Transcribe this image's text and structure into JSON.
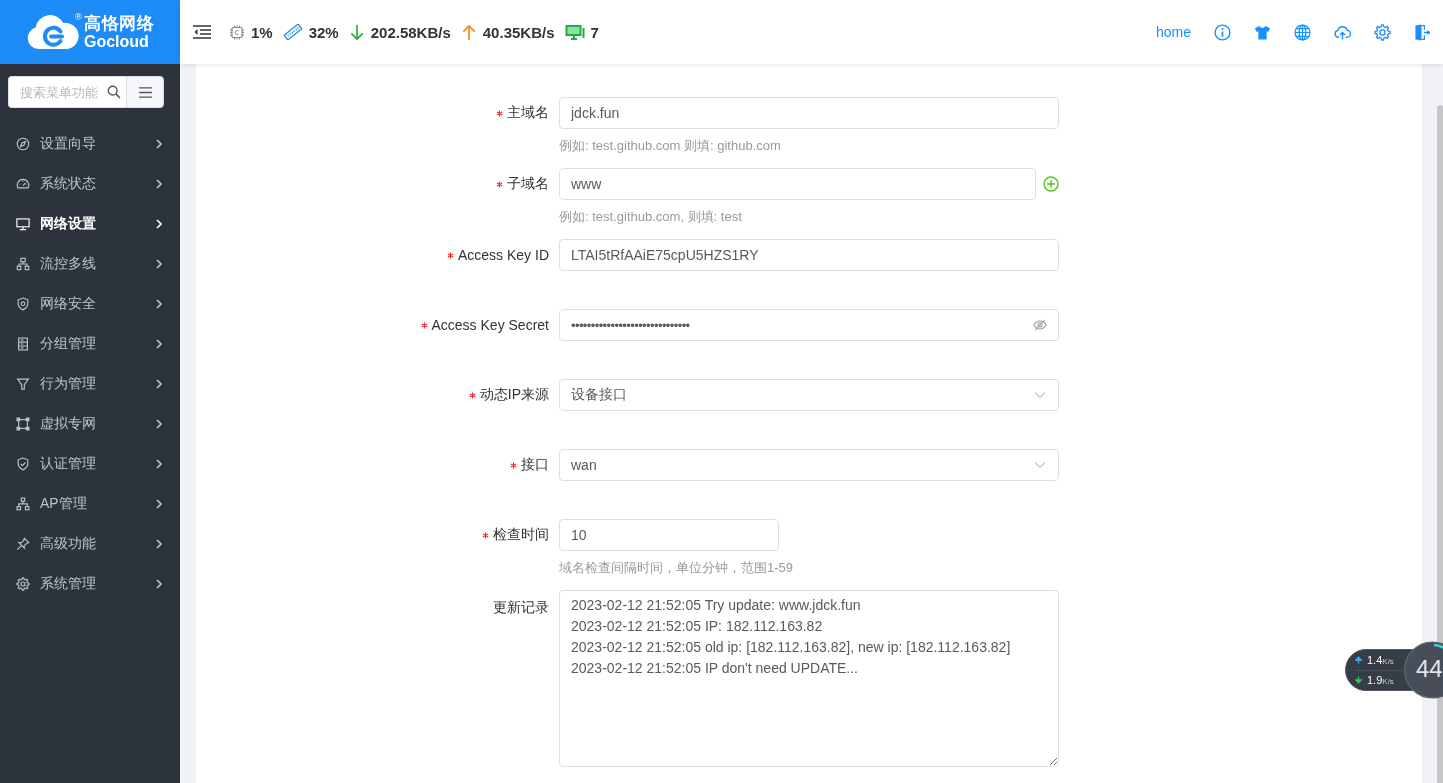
{
  "header": {
    "logo": {
      "brand_cn": "高恪网络",
      "brand_en": "Gocloud",
      "registered_mark": "®"
    },
    "stats": [
      {
        "kind": "cpu",
        "value": "1%"
      },
      {
        "kind": "memory",
        "value": "32%"
      },
      {
        "kind": "download",
        "value": "202.58KB/s"
      },
      {
        "kind": "upload",
        "value": "40.35KB/s"
      },
      {
        "kind": "devices",
        "value": "7"
      }
    ],
    "home_link": "home"
  },
  "sidebar": {
    "search": {
      "placeholder": "搜索菜单功能"
    },
    "items": [
      {
        "kind": "wizard",
        "label": "设置向导",
        "selected": false
      },
      {
        "kind": "status",
        "label": "系统状态",
        "selected": false
      },
      {
        "kind": "network",
        "label": "网络设置",
        "selected": true
      },
      {
        "kind": "flow",
        "label": "流控多线",
        "selected": false
      },
      {
        "kind": "security",
        "label": "网络安全",
        "selected": false
      },
      {
        "kind": "group",
        "label": "分组管理",
        "selected": false
      },
      {
        "kind": "behavior",
        "label": "行为管理",
        "selected": false
      },
      {
        "kind": "vpn",
        "label": "虚拟专网",
        "selected": false
      },
      {
        "kind": "auth",
        "label": "认证管理",
        "selected": false
      },
      {
        "kind": "ap",
        "label": "AP管理",
        "selected": false
      },
      {
        "kind": "advanced",
        "label": "高级功能",
        "selected": false
      },
      {
        "kind": "system",
        "label": "系统管理",
        "selected": false
      }
    ]
  },
  "form": {
    "fields": [
      {
        "kind": "text",
        "label": "主域名",
        "required": true,
        "value": "jdck.fun",
        "hint": "例如: test.github.com 则填: github.com",
        "addable": false
      },
      {
        "kind": "text",
        "label": "子域名",
        "required": true,
        "value": "www",
        "hint": "例如: test.github.com, 则填: test",
        "addable": true
      },
      {
        "kind": "text",
        "label": "Access Key ID",
        "required": true,
        "value": "LTAI5tRfAAiE75cpU5HZS1RY",
        "addable": false
      },
      {
        "kind": "password",
        "label": "Access Key Secret",
        "required": true,
        "value": "••••••••••••••••••••••••••••••",
        "revealed": false
      },
      {
        "kind": "select",
        "label": "动态IP来源",
        "required": true,
        "value": "设备接口"
      },
      {
        "kind": "select",
        "label": "接口",
        "required": true,
        "value": "wan"
      },
      {
        "kind": "number",
        "label": "检查时间",
        "required": true,
        "value": "10",
        "hint": "域名检查间隔时间，单位分钟，范围1-59"
      },
      {
        "kind": "textarea",
        "label": "更新记录",
        "required": false,
        "lines": [
          "2023-02-12 21:52:05 Try update: www.jdck.fun",
          "2023-02-12 21:52:05 IP: 182.112.163.82",
          "2023-02-12 21:52:05 old ip: [182.112.163.82], new ip: [182.112.163.82]",
          "2023-02-12 21:52:05 IP don't need UPDATE..."
        ]
      }
    ]
  },
  "speed_widget": {
    "upload": {
      "value": "1.4",
      "unit": "K/s"
    },
    "download": {
      "value": "1.9",
      "unit": "K/s"
    },
    "gauge": "44"
  }
}
